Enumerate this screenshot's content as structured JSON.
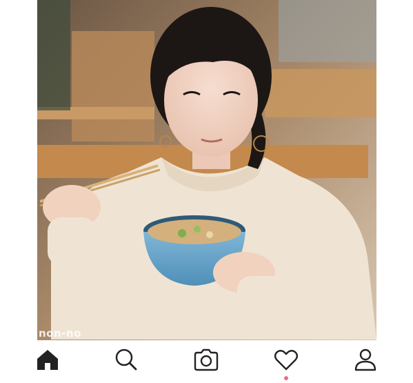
{
  "photo": {
    "watermark": "non-no"
  },
  "tab_bar": {
    "items": [
      {
        "name": "home",
        "icon": "home-icon",
        "active": true
      },
      {
        "name": "search",
        "icon": "search-icon",
        "active": false
      },
      {
        "name": "camera",
        "icon": "camera-icon",
        "active": false
      },
      {
        "name": "activity",
        "icon": "heart-icon",
        "active": false,
        "notification": true
      },
      {
        "name": "profile",
        "icon": "profile-icon",
        "active": false
      }
    ]
  },
  "colors": {
    "icon": "#222222",
    "notification_dot": "#e0727e",
    "background": "#ffffff"
  }
}
